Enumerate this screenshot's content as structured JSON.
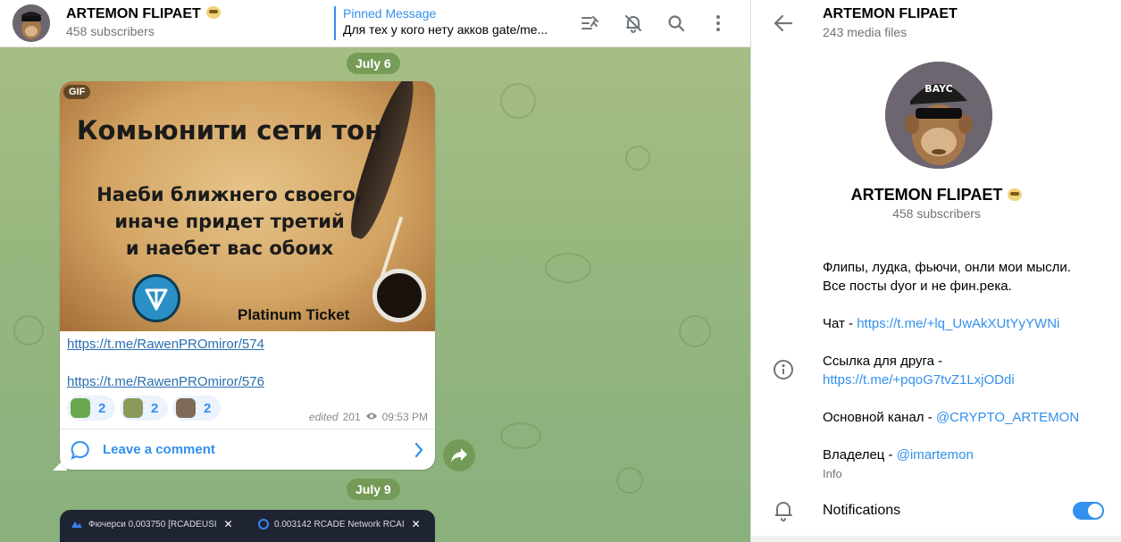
{
  "header": {
    "title": "ARTEMON FLIPAET",
    "subtitle": "458 subscribers",
    "pinned_title": "Pinned Message",
    "pinned_text": "Для тех у кого нету акков gate/me..."
  },
  "icons": {
    "pin_list": "pinned-list-icon",
    "mute": "bell-off-icon",
    "search": "search-icon",
    "more": "more-vertical-icon",
    "back": "arrow-left-icon",
    "info": "info-icon",
    "bell": "bell-icon",
    "share": "share-arrow-icon",
    "comment": "comment-bubble-icon",
    "chevron": "chevron-right-icon",
    "views": "eye-icon"
  },
  "chat": {
    "date1": "July 6",
    "date2": "July 9",
    "post": {
      "gif_badge": "GIF",
      "gif_heading": "Комьюнити сети тон",
      "gif_lines": [
        "Наеби ближнего своего,",
        "иначе придет третий",
        "и наебет вас обоих"
      ],
      "gif_footer": "Platinum Ticket",
      "links": [
        "https://t.me/RawenPROmiror/574",
        "https://t.me/RawenPROmiror/576"
      ],
      "reactions": [
        {
          "count": "2",
          "color": "#6aa84f"
        },
        {
          "count": "2",
          "color": "#8a9a5b"
        },
        {
          "count": "2",
          "color": "#7f6a5a"
        }
      ],
      "edited": "edited",
      "views": "201",
      "time": "09:53 PM",
      "comment_label": "Leave a comment"
    },
    "post2_tabs": [
      "Фючерси 0,003750 [RCADEUSI",
      "0.003142 RCADE Network RCAI"
    ]
  },
  "profile": {
    "top_title": "ARTEMON FLIPAET",
    "top_sub": "243 media files",
    "name": "ARTEMON FLIPAET",
    "subscribers": "458 subscribers",
    "desc_line1": "Флипы, лудка, фьючи, онли мои мысли.",
    "desc_line2": "Все посты dyor и не фин.река.",
    "chat_prefix": "Чат - ",
    "chat_link": "https://t.me/+lq_UwAkXUtYyYWNi",
    "friend_prefix": "Ссылка для друга - ",
    "friend_link": "https://t.me/+pqoG7tvZ1LxjODdi",
    "main_prefix": "Основной канал - ",
    "main_link": "@CRYPTO_ARTEMON",
    "owner_prefix": "Владелец - ",
    "owner_link": "@imartemon",
    "info_label": "Info",
    "notifications_label": "Notifications",
    "notifications_enabled": true
  },
  "colors": {
    "accent": "#3390ec",
    "chat_bg": "#98b77f",
    "date_pill": "#6e9650"
  }
}
